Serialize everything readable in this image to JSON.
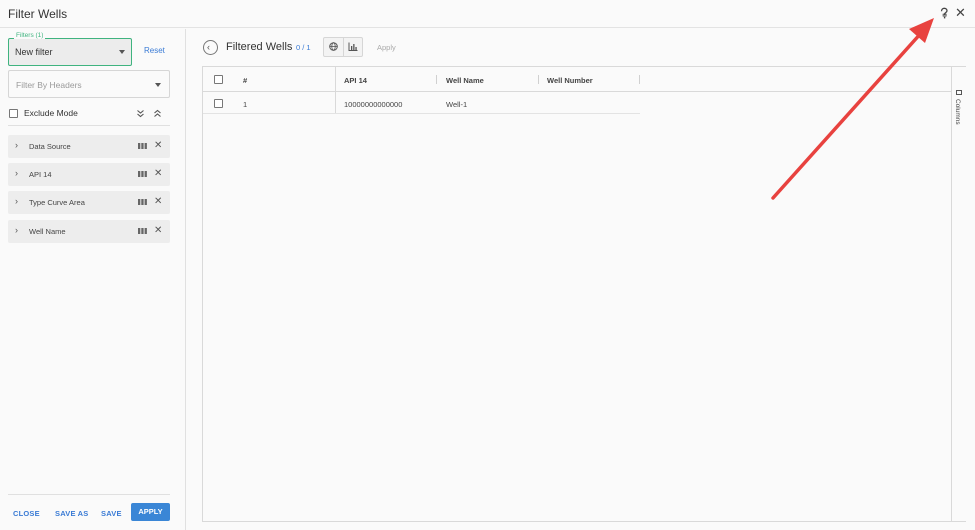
{
  "window": {
    "title": "Filter Wells"
  },
  "titlebar": {
    "help_icon": "help-icon",
    "close_icon": "close-icon"
  },
  "left_panel": {
    "filter_select": {
      "legend": "Filters (1)",
      "value": "New filter"
    },
    "reset_label": "Reset",
    "headers_select": {
      "placeholder": "Filter By Headers"
    },
    "exclude_mode": {
      "label": "Exclude Mode",
      "checked": false
    },
    "filters": [
      {
        "label": "Data Source"
      },
      {
        "label": "API 14"
      },
      {
        "label": "Type Curve Area"
      },
      {
        "label": "Well Name"
      }
    ],
    "actions": {
      "close": "CLOSE",
      "save_as": "SAVE AS",
      "save": "SAVE",
      "apply": "APPLY"
    }
  },
  "right_panel": {
    "title": "Filtered Wells",
    "count": "0 / 1",
    "apply_label": "Apply",
    "table": {
      "columns": [
        "#",
        "API 14",
        "Well Name",
        "Well Number"
      ],
      "rows": [
        {
          "index": "1",
          "api14": "10000000000000",
          "well_name": "Well-1",
          "well_number": ""
        }
      ]
    },
    "side_tab_label": "Columns"
  },
  "colors": {
    "accent": "#3a86d6",
    "focus_green": "#3fb37f",
    "annotation_arrow": "#e8423f"
  }
}
